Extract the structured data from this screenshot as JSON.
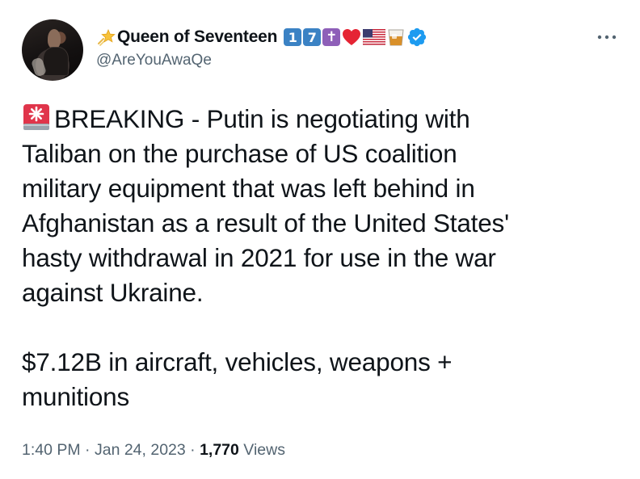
{
  "author": {
    "display_name": "Queen of Seventeen",
    "handle": "@AreYouAwaQe",
    "badges": {
      "key1": "1",
      "key7": "7",
      "cross": "✝"
    }
  },
  "tweet": {
    "lines": [
      "BREAKING - Putin is negotiating with",
      "Taliban on the purchase of US coalition",
      "military equipment that was left behind in",
      "Afghanistan as a result of the United States'",
      "hasty withdrawal in 2021 for use in the war",
      "against Ukraine."
    ],
    "lines2": [
      "$7.12B in aircraft, vehicles, weapons +",
      "munitions"
    ]
  },
  "meta": {
    "time": "1:40 PM",
    "sep1": " · ",
    "date": "Jan 24, 2023",
    "sep2": " · ",
    "views_count": "1,770",
    "views_label": " Views"
  },
  "colors": {
    "text": "#0f1419",
    "secondary": "#536471",
    "verified": "#1d9bf0",
    "siren": "#e0354b"
  }
}
